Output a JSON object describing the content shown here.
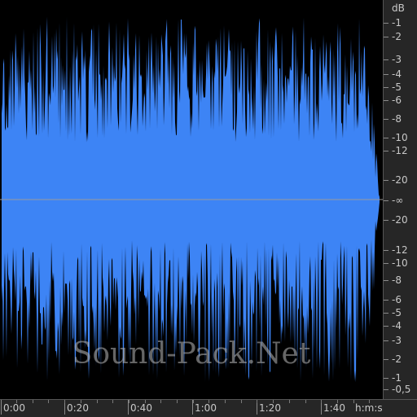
{
  "waveform": {
    "color": "#3d84f5",
    "centerline_color": "#9a9a9a",
    "background": "#000000"
  },
  "db_ruler": {
    "unit": "dB",
    "labels": [
      "-1",
      "-2",
      "-3",
      "-4",
      "-5",
      "-6",
      "-8",
      "-10",
      "-12",
      "-20",
      "-∞",
      "-20",
      "-12",
      "-10",
      "-8",
      "-6",
      "-5",
      "-4",
      "-3",
      "-2",
      "-1",
      "-0,5"
    ]
  },
  "time_ruler": {
    "labels": [
      "0:00",
      "0:20",
      "0:40",
      "1:00",
      "1:20",
      "1:40"
    ],
    "unit": "h:m:s"
  },
  "watermark": "Sound-Pack.Net"
}
